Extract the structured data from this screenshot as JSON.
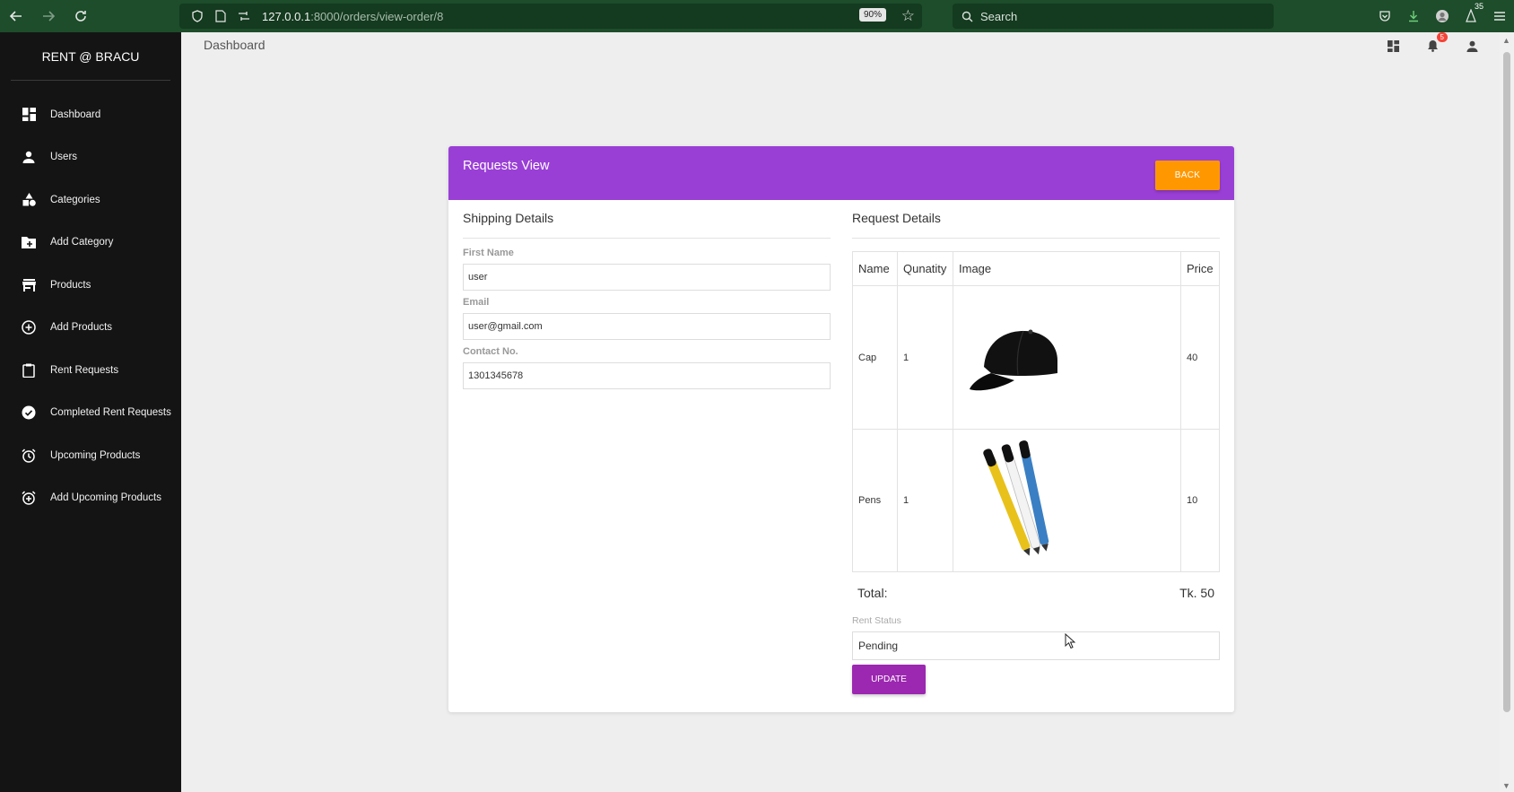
{
  "browser": {
    "url_host": "127.0.0.1",
    "url_path": ":8000/orders/view-order/8",
    "zoom": "90%",
    "search_placeholder": "Search",
    "extension_badge": "35"
  },
  "sidebar": {
    "brand": "RENT @ BRACU",
    "items": [
      {
        "label": "Dashboard",
        "icon": "dashboard-icon"
      },
      {
        "label": "Users",
        "icon": "person-icon"
      },
      {
        "label": "Categories",
        "icon": "category-icon"
      },
      {
        "label": "Add Category",
        "icon": "add-folder-icon"
      },
      {
        "label": "Products",
        "icon": "store-icon"
      },
      {
        "label": "Add Products",
        "icon": "add-circle-icon"
      },
      {
        "label": "Rent Requests",
        "icon": "clipboard-icon"
      },
      {
        "label": "Completed Rent Requests",
        "icon": "check-circle-icon"
      },
      {
        "label": "Upcoming Products",
        "icon": "alarm-icon"
      },
      {
        "label": "Add Upcoming Products",
        "icon": "alarm-add-icon"
      }
    ]
  },
  "header": {
    "breadcrumb": "Dashboard",
    "notification_count": "5"
  },
  "card": {
    "title": "Requests View",
    "back_label": "BACK",
    "shipping": {
      "title": "Shipping Details",
      "first_name_label": "First Name",
      "first_name_value": "user",
      "email_label": "Email",
      "email_value": "user@gmail.com",
      "contact_label": "Contact No.",
      "contact_value": "1301345678"
    },
    "request": {
      "title": "Request Details",
      "columns": [
        "Name",
        "Qunatity",
        "Image",
        "Price"
      ],
      "rows": [
        {
          "name": "Cap",
          "quantity": "1",
          "image": "cap-image",
          "price": "40"
        },
        {
          "name": "Pens",
          "quantity": "1",
          "image": "pens-image",
          "price": "10"
        }
      ],
      "total_label": "Total:",
      "total_value": "Tk. 50",
      "status_label": "Rent Status",
      "status_value": "Pending",
      "update_label": "UPDATE"
    }
  },
  "colors": {
    "header_purple": "#9a3fd6",
    "back_orange": "#ff9800",
    "update_purple": "#9c27b0",
    "sidebar_bg": "#141414",
    "browser_green": "#1d4d2a"
  }
}
